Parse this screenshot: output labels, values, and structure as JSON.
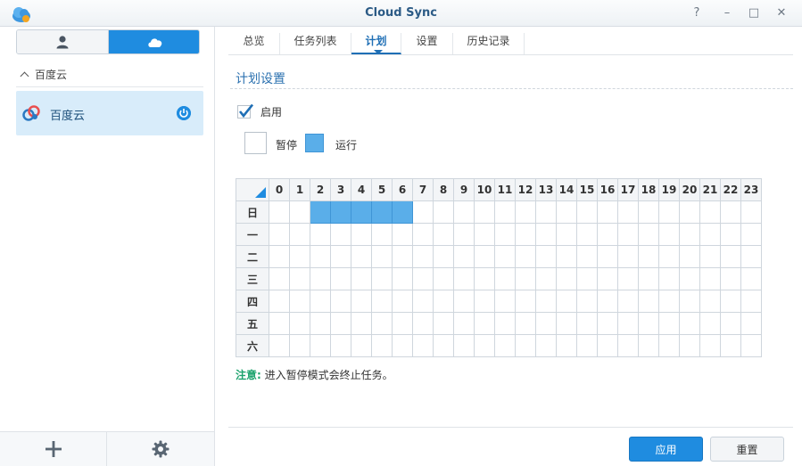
{
  "window": {
    "title": "Cloud Sync",
    "controls": [
      "?",
      "–",
      "□",
      "✕"
    ]
  },
  "sidebar": {
    "segments": [
      "user-icon",
      "cloud-icon"
    ],
    "group_label": "百度云",
    "items": [
      {
        "label": "百度云",
        "status": "on"
      }
    ]
  },
  "tabs": [
    "总览",
    "任务列表",
    "计划",
    "设置",
    "历史记录"
  ],
  "active_tab": "计划",
  "section": {
    "title": "计划设置",
    "enable_label": "启用",
    "enable_checked": true,
    "legend_pause": "暂停",
    "legend_run": "运行"
  },
  "schedule": {
    "hours": [
      "0",
      "1",
      "2",
      "3",
      "4",
      "5",
      "6",
      "7",
      "8",
      "9",
      "10",
      "11",
      "12",
      "13",
      "14",
      "15",
      "16",
      "17",
      "18",
      "19",
      "20",
      "21",
      "22",
      "23"
    ],
    "days": [
      "日",
      "一",
      "二",
      "三",
      "四",
      "五",
      "六"
    ],
    "running": {
      "日": [
        2,
        3,
        4,
        5,
        6
      ]
    }
  },
  "note": {
    "label": "注意:",
    "text": "进入暂停模式会终止任务。"
  },
  "buttons": {
    "apply": "应用",
    "reset": "重置"
  },
  "colors": {
    "accent": "#1f8ce0",
    "run_cell": "#5aaee9",
    "note_label": "#1da36e"
  }
}
